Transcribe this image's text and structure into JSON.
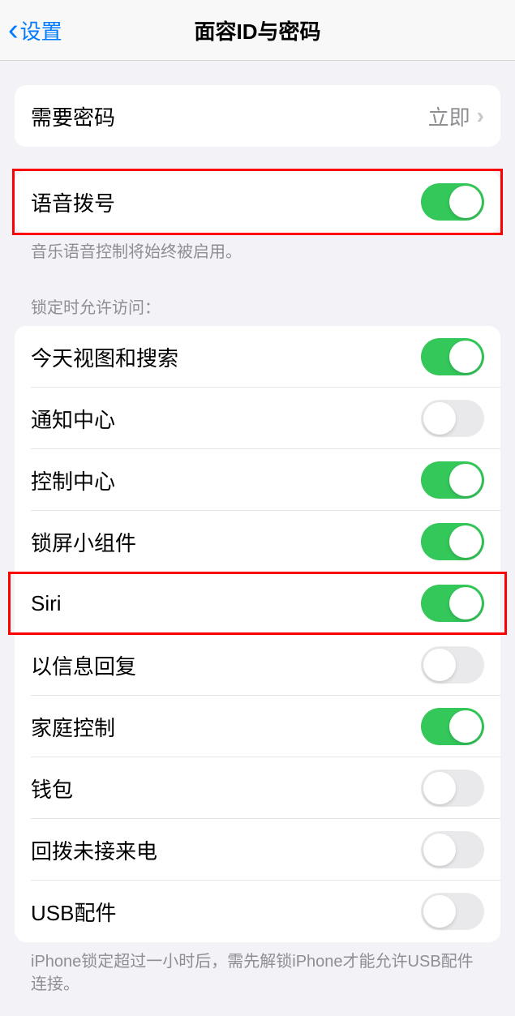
{
  "nav": {
    "back_label": "设置",
    "title": "面容ID与密码"
  },
  "passcode_group": {
    "require_passcode_label": "需要密码",
    "require_passcode_value": "立即"
  },
  "voice_dial": {
    "label": "语音拨号",
    "enabled": true,
    "footer": "音乐语音控制将始终被启用。"
  },
  "lock_access": {
    "header": "锁定时允许访问：",
    "items": [
      {
        "label": "今天视图和搜索",
        "enabled": true
      },
      {
        "label": "通知中心",
        "enabled": false
      },
      {
        "label": "控制中心",
        "enabled": true
      },
      {
        "label": "锁屏小组件",
        "enabled": true
      },
      {
        "label": "Siri",
        "enabled": true
      },
      {
        "label": "以信息回复",
        "enabled": false
      },
      {
        "label": "家庭控制",
        "enabled": true
      },
      {
        "label": "钱包",
        "enabled": false
      },
      {
        "label": "回拨未接来电",
        "enabled": false
      },
      {
        "label": "USB配件",
        "enabled": false
      }
    ],
    "footer": "iPhone锁定超过一小时后，需先解锁iPhone才能允许USB配件连接。"
  }
}
